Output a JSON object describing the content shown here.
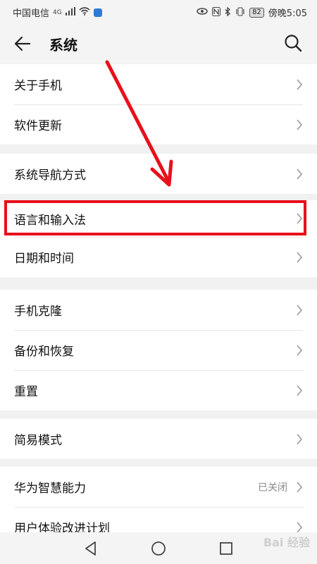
{
  "status_bar": {
    "carrier": "中国电信",
    "network": "4G",
    "battery": "82",
    "time": "傍晚5:05"
  },
  "header": {
    "title": "系统"
  },
  "groups": [
    {
      "items": [
        {
          "label": "关于手机"
        },
        {
          "label": "软件更新"
        }
      ]
    },
    {
      "items": [
        {
          "label": "系统导航方式"
        }
      ]
    },
    {
      "items": [
        {
          "label": "语言和输入法"
        },
        {
          "label": "日期和时间"
        }
      ]
    },
    {
      "items": [
        {
          "label": "手机克隆"
        },
        {
          "label": "备份和恢复"
        },
        {
          "label": "重置"
        }
      ]
    },
    {
      "items": [
        {
          "label": "简易模式"
        }
      ]
    },
    {
      "items": [
        {
          "label": "华为智慧能力",
          "value": "已关闭"
        },
        {
          "label": "用户体验改进计划"
        }
      ]
    }
  ],
  "watermark": "Bai 经验",
  "colors": {
    "highlight": "#e8101a",
    "background": "#f1f1f1"
  }
}
